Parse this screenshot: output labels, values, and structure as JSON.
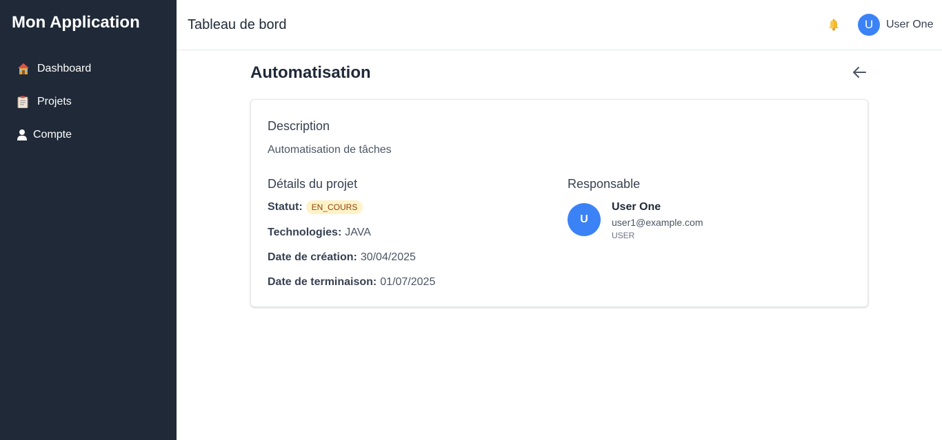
{
  "app": {
    "title": "Mon Application"
  },
  "sidebar": {
    "items": [
      {
        "label": "Dashboard",
        "icon": "house-icon"
      },
      {
        "label": "Projets",
        "icon": "clipboard-icon"
      },
      {
        "label": "Compte",
        "icon": "user-icon"
      }
    ]
  },
  "header": {
    "title": "Tableau de bord",
    "notification_icon": "bell-icon",
    "user": {
      "initial": "U",
      "name": "User One"
    }
  },
  "project": {
    "title": "Automatisation",
    "back_icon": "arrow-left-icon",
    "description_title": "Description",
    "description": "Automatisation de tâches",
    "details_title": "Détails du projet",
    "status_label": "Statut:",
    "status_value": "EN_COURS",
    "technologies_label": "Technologies:",
    "technologies_value": "JAVA",
    "created_label": "Date de création:",
    "created_value": "30/04/2025",
    "end_label": "Date de terminaison:",
    "end_value": "01/07/2025",
    "responsable_title": "Responsable",
    "responsable": {
      "initial": "U",
      "name": "User One",
      "email": "user1@example.com",
      "role": "USER"
    }
  },
  "colors": {
    "sidebar_bg": "#1f2937",
    "accent": "#3b82f6",
    "badge_bg": "#fef3c7",
    "badge_text": "#92400e"
  }
}
